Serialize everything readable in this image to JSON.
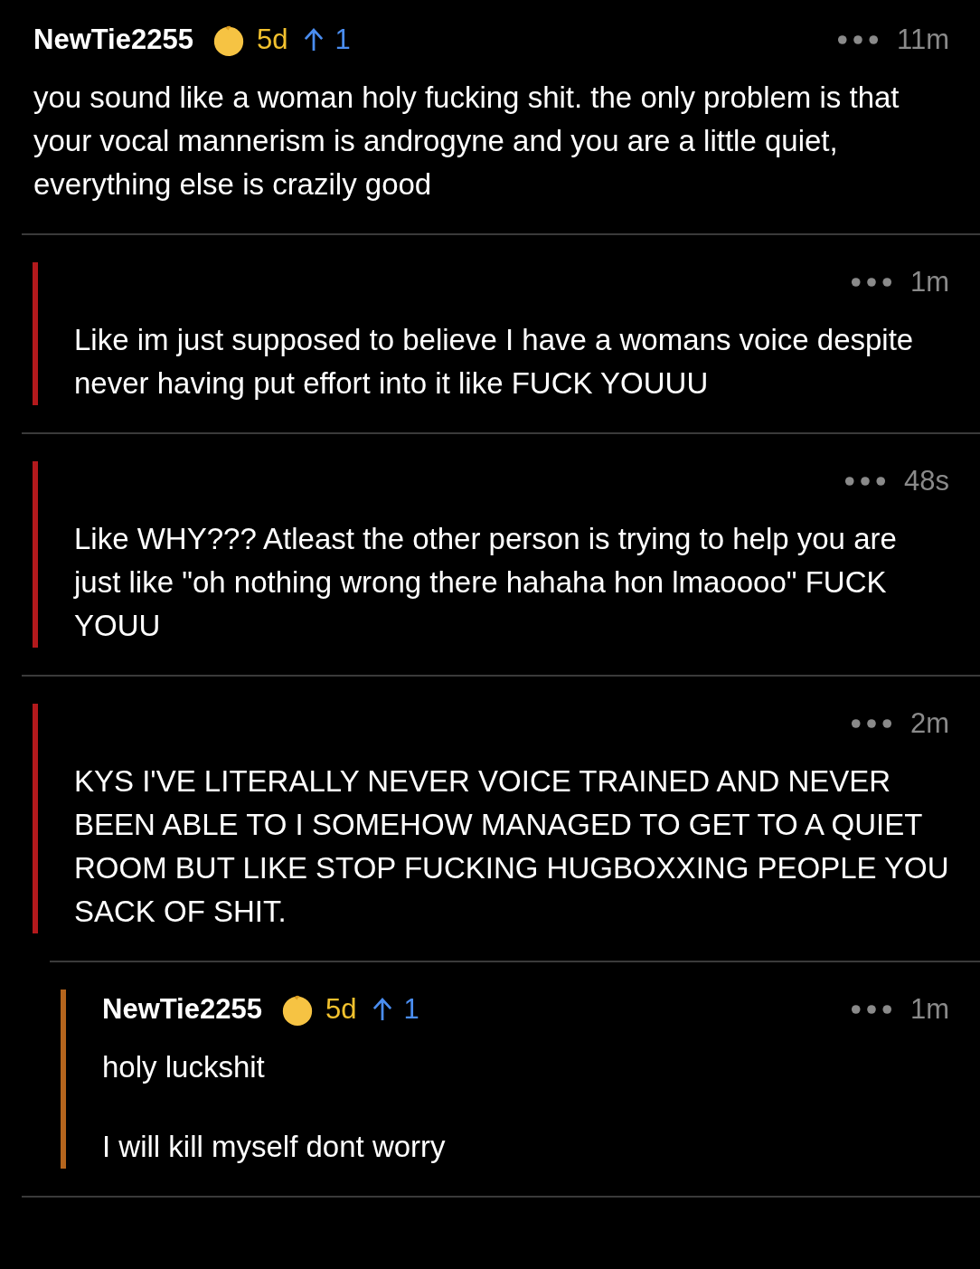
{
  "comments": [
    {
      "author": "NewTie2255",
      "age": "5d",
      "score": "1",
      "time": "11m",
      "paragraphs": [
        "you sound like a woman holy fucking shit. the only problem is that your vocal mannerism is androgyne and you are a little quiet, everything else is crazily good"
      ]
    },
    {
      "color": "#b3191c",
      "time": "1m",
      "paragraphs": [
        "Like im just supposed to believe I have a womans voice despite never having put effort into it like FUCK YOUUU"
      ]
    },
    {
      "color": "#b3191c",
      "time": "48s",
      "paragraphs": [
        "Like WHY??? Atleast the other person is trying to help you are just like \"oh nothing wrong there hahaha hon lmaoooo\" FUCK YOUU"
      ]
    },
    {
      "color": "#b3191c",
      "time": "2m",
      "paragraphs": [
        "KYS I'VE LITERALLY NEVER VOICE TRAINED AND NEVER BEEN ABLE TO I SOMEHOW MANAGED TO GET TO A QUIET ROOM BUT LIKE STOP FUCKING HUGBOXXING PEOPLE YOU SACK OF SHIT."
      ],
      "children": [
        {
          "color": "#b5651d",
          "author": "NewTie2255",
          "age": "5d",
          "score": "1",
          "time": "1m",
          "paragraphs": [
            "holy luckshit",
            "I will kill myself dont worry"
          ]
        }
      ]
    }
  ]
}
